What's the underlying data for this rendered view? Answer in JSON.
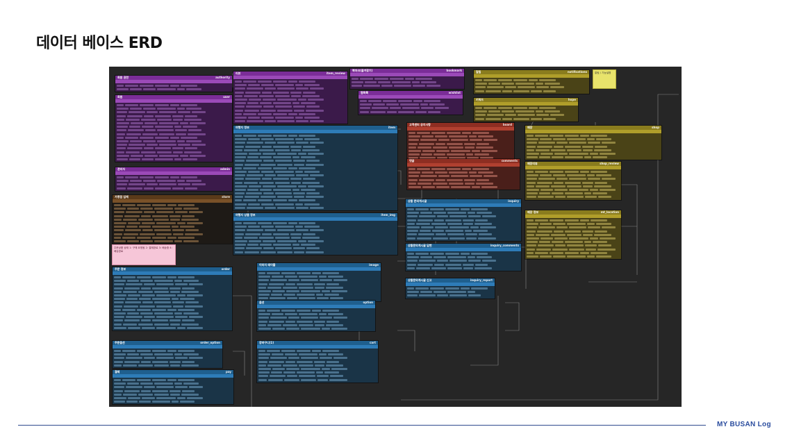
{
  "slide": {
    "title": "데이터 베이스 ERD"
  },
  "footer": {
    "brand": "MY BUSAN Log"
  },
  "notes": {
    "yellow": "알림 / 기능설명",
    "pink": "주문상품 상태 1: 구매 요청됨 2: 결제완료 3: 배송중 4: 배송완료"
  },
  "tables": [
    {
      "key": "authority",
      "title": "회원 권한",
      "name": "authority",
      "rows": 2
    },
    {
      "key": "user",
      "title": "회원",
      "name": "user",
      "rows": 16
    },
    {
      "key": "admin",
      "title": "관리자",
      "name": "admin",
      "rows": 4
    },
    {
      "key": "store",
      "title": "가맹점 업체",
      "name": "store",
      "rows": 11
    },
    {
      "key": "order",
      "title": "주문 정보",
      "name": "order",
      "rows": 15
    },
    {
      "key": "order_option",
      "title": "주문옵션",
      "name": "order_option",
      "rows": 5
    },
    {
      "key": "pay",
      "title": "결제",
      "name": "pay",
      "rows": 7
    },
    {
      "key": "item_review",
      "title": "리뷰",
      "name": "item_review",
      "rows": 12
    },
    {
      "key": "bookmark",
      "title": "북마크(즐겨찾기)",
      "name": "bookmark",
      "rows": 3
    },
    {
      "key": "wishlist",
      "title": "찜목록",
      "name": "wishlist",
      "rows": 4
    },
    {
      "key": "item",
      "title": "여행지 정보",
      "name": "item",
      "rows": 21
    },
    {
      "key": "item_img",
      "title": "여행지 상품 정보",
      "name": "item_img",
      "rows": 9
    },
    {
      "key": "image",
      "title": "이미지 테이블",
      "name": "image",
      "rows": 8
    },
    {
      "key": "option",
      "title": "옵션",
      "name": "option",
      "rows": 6
    },
    {
      "key": "cart",
      "title": "장바구니(1)",
      "name": "cart",
      "rows": 9
    },
    {
      "key": "notifications",
      "title": "알림",
      "name": "notifications",
      "rows": 4
    },
    {
      "key": "hope",
      "title": "키워드",
      "name": "hope",
      "rows": 4
    },
    {
      "key": "board",
      "title": "고객센터 공지사항",
      "name": "board",
      "rows": 8
    },
    {
      "key": "comments",
      "title": "댓글",
      "name": "comments",
      "rows": 6
    },
    {
      "key": "shop",
      "title": "매장",
      "name": "shop",
      "rows": 7
    },
    {
      "key": "shop_review",
      "title": "매장리뷰",
      "name": "shop_review",
      "rows": 8
    },
    {
      "key": "inquiry",
      "title": "상품 문의게시글",
      "name": "inquiry",
      "rows": 9
    },
    {
      "key": "inquiry_comments",
      "title": "상품문의게시글 답변",
      "name": "inquiry_comments",
      "rows": 5
    },
    {
      "key": "inquiry_report",
      "title": "상품문의게시글 신고",
      "name": "inquiry_report",
      "rows": 3
    },
    {
      "key": "mt_location",
      "title": "매장 정보",
      "name": "mt_location",
      "rows": 11
    }
  ],
  "colors": {
    "purple": "#7b2d98",
    "blue": "#1f5f8e",
    "olive": "#8a7c1e",
    "red": "#8e2e22",
    "brown": "#5a3a1a",
    "canvas": "#262626"
  }
}
